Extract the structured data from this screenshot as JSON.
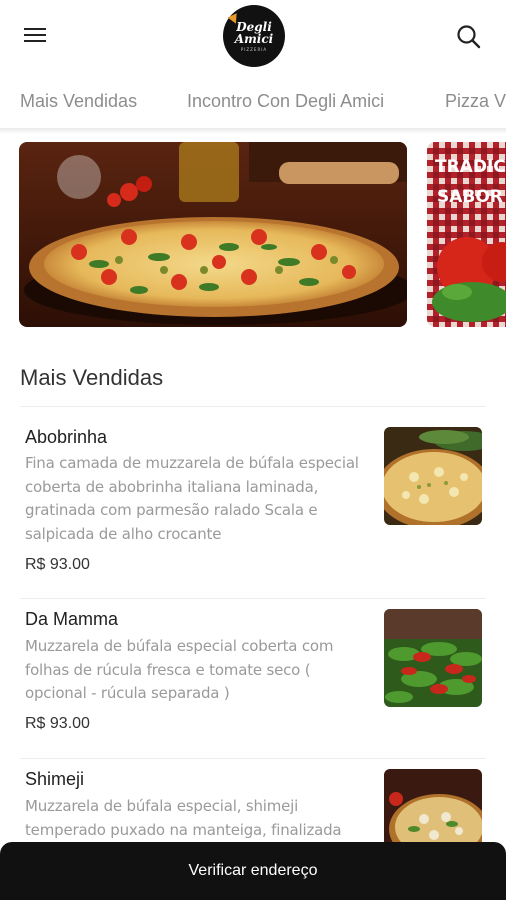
{
  "header": {
    "menu_icon": "hamburger-menu-icon",
    "logo_line1": "Degli",
    "logo_line2": "Amici",
    "logo_line3": "PIZZERIA",
    "search_icon": "search-icon"
  },
  "tabs": [
    {
      "label": "Mais Vendidas"
    },
    {
      "label": "Incontro Con Degli Amici"
    },
    {
      "label": "Pizza V"
    }
  ],
  "banners": [
    {
      "name": "pizza-banner"
    },
    {
      "line1": "TRADICI",
      "line2": "SABOR D"
    }
  ],
  "section": {
    "title": "Mais Vendidas"
  },
  "items": [
    {
      "name": "Abobrinha",
      "desc": [
        "Fina camada de muzzarela de búfala especial",
        "coberta de abobrinha italiana laminada,",
        "gratinada com parmesão ralado Scala e",
        "salpicada de alho crocante"
      ],
      "price": "R$ 93.00"
    },
    {
      "name": "Da Mamma",
      "desc": [
        "Muzzarela de búfala especial coberta com",
        "folhas de rúcula fresca e tomate seco (",
        "opcional - rúcula separada )"
      ],
      "price": "R$ 93.00"
    },
    {
      "name": "Shimeji",
      "desc": [
        "Muzzarela de búfala especial, shimeji",
        "temperado puxado na manteiga, finalizada"
      ],
      "price": ""
    }
  ],
  "bottom_bar": {
    "label": "Verificar endereço"
  },
  "colors": {
    "bottom_bar": "#111111",
    "tab_text": "#8d8d8d",
    "desc_text": "#9a9a9a"
  }
}
